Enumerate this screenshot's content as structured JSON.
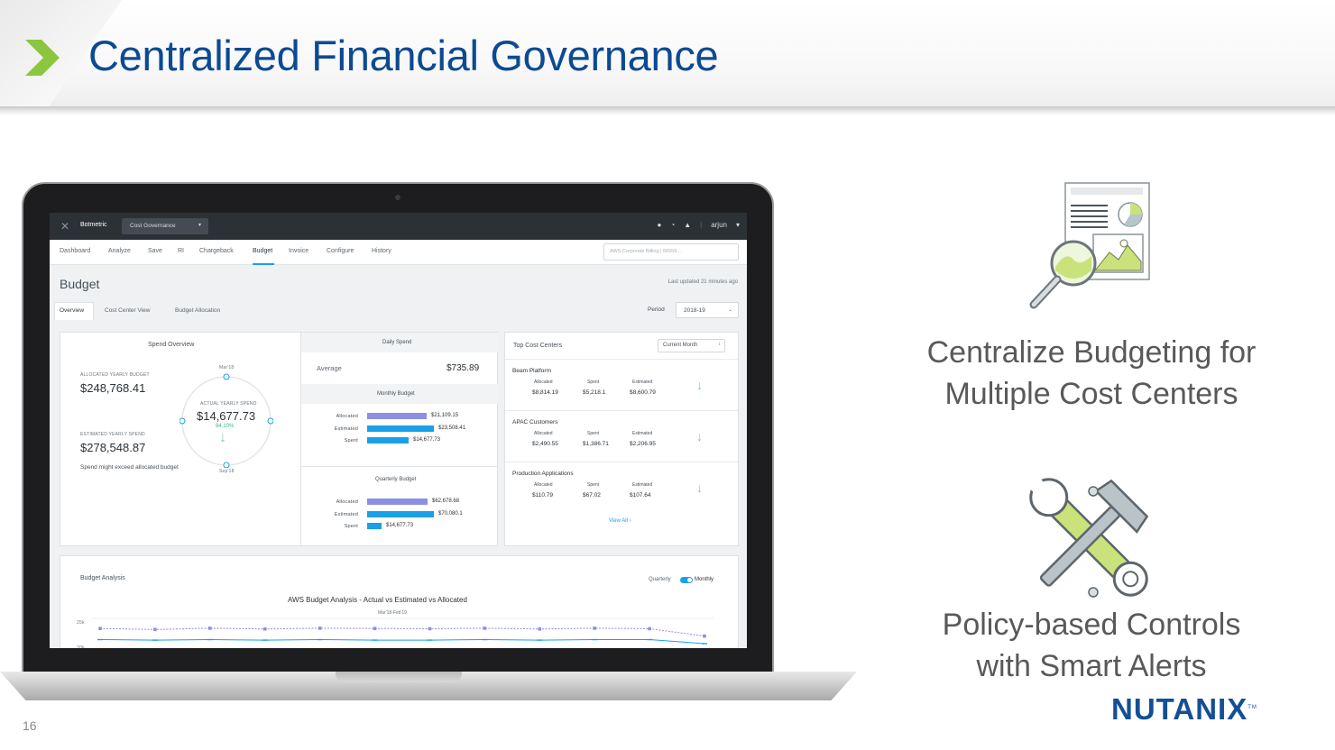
{
  "slide": {
    "title": "Centralized Financial Governance",
    "page_number": "16",
    "features": [
      {
        "line1": "Centralize Budgeting for",
        "line2": "Multiple Cost Centers",
        "icon": "report-magnifier-icon"
      },
      {
        "line1": "Policy-based Controls",
        "line2": "with Smart Alerts",
        "icon": "tools-icon"
      }
    ],
    "logo": "NUTANIX",
    "logo_tm": "TM",
    "colors": {
      "title_blue": "#0c4a92",
      "chevron_green": "#8cc63f",
      "accent_blue": "#1aa0e6",
      "purple": "#8b8fe6",
      "green_arrow": "#7fd3b0"
    }
  },
  "app": {
    "brand": "Botmetric",
    "module_select": "Cost Governance",
    "user": "arjun",
    "nav": [
      "Dashboard",
      "Analyze",
      "Save",
      "RI",
      "Chargeback",
      "Budget",
      "Invoice",
      "Configure",
      "History"
    ],
    "active_nav": "Budget",
    "account_select": "AWS Corporate Billing | 66559...",
    "page_title": "Budget",
    "last_updated": "Last updated 21 minutes ago",
    "subtabs": [
      "Overview",
      "Cost Center View",
      "Budget Allocation"
    ],
    "period_label": "Period",
    "period_value": "2018-19",
    "spend_overview": {
      "title": "Spend Overview",
      "allocated_label": "ALLOCATED YEARLY BUDGET",
      "allocated_value": "$248,768.41",
      "estimated_label": "ESTIMATED YEARLY SPEND",
      "estimated_value": "$278,548.87",
      "warning": "Spend might exceed allocated budget",
      "gauge_top": "Mar'18",
      "gauge_bottom": "Sep'18",
      "actual_label": "ACTUAL YEARLY SPEND",
      "actual_value": "$14,677.73",
      "actual_pct": "94.10%"
    },
    "daily_spend": {
      "title": "Daily Spend",
      "average_label": "Average",
      "average_value": "$735.89"
    },
    "monthly_budget": {
      "title": "Monthly Budget",
      "rows": [
        {
          "label": "Allocated",
          "value": "$21,109.15",
          "fraction": 0.89
        },
        {
          "label": "Estimated",
          "value": "$23,508.41",
          "fraction": 1.0
        },
        {
          "label": "Spent",
          "value": "$14,677.73",
          "fraction": 0.62
        }
      ]
    },
    "quarterly_budget": {
      "title": "Quarterly Budget",
      "rows": [
        {
          "label": "Allocated",
          "value": "$62,678.68",
          "fraction": 0.9
        },
        {
          "label": "Estimated",
          "value": "$70,080.1",
          "fraction": 1.0
        },
        {
          "label": "Spent",
          "value": "$14,677.73",
          "fraction": 0.21
        }
      ]
    },
    "top_cost_centers": {
      "title": "Top Cost Centers",
      "select": "Current Month",
      "col_allocated": "Allocated",
      "col_spent": "Spent",
      "col_estimated": "Estimated",
      "view_all": "View All",
      "items": [
        {
          "name": "Beam Platform",
          "allocated": "$8,814.19",
          "spent": "$5,218.1",
          "estimated": "$8,600.79"
        },
        {
          "name": "APAC Customers",
          "allocated": "$2,490.55",
          "spent": "$1,386.71",
          "estimated": "$2,206.95"
        },
        {
          "name": "Production Applications",
          "allocated": "$110.79",
          "spent": "$67.02",
          "estimated": "$107.64"
        }
      ]
    },
    "budget_analysis": {
      "title": "Budget Analysis",
      "toggle_left": "Quarterly",
      "toggle_right": "Monthly",
      "chart_title": "AWS Budget Analysis - Actual vs Estimated vs Allocated",
      "chart_subtitle": "Mar'18-Feb'19",
      "y_ticks": [
        "25k",
        "20k"
      ]
    }
  },
  "chart_data": {
    "type": "line",
    "title": "AWS Budget Analysis - Actual vs Estimated vs Allocated",
    "subtitle": "Mar'18-Feb'19",
    "ylim": [
      20000,
      25000
    ],
    "series": [
      {
        "values": [
          23000,
          22800,
          23050,
          22900,
          23050,
          23000,
          22950,
          23050,
          22900,
          23050,
          22950,
          21500
        ]
      },
      {
        "values": [
          20800,
          20700,
          20800,
          20700,
          20800,
          20700,
          20700,
          20800,
          20700,
          20800,
          20800,
          20000
        ]
      }
    ]
  }
}
